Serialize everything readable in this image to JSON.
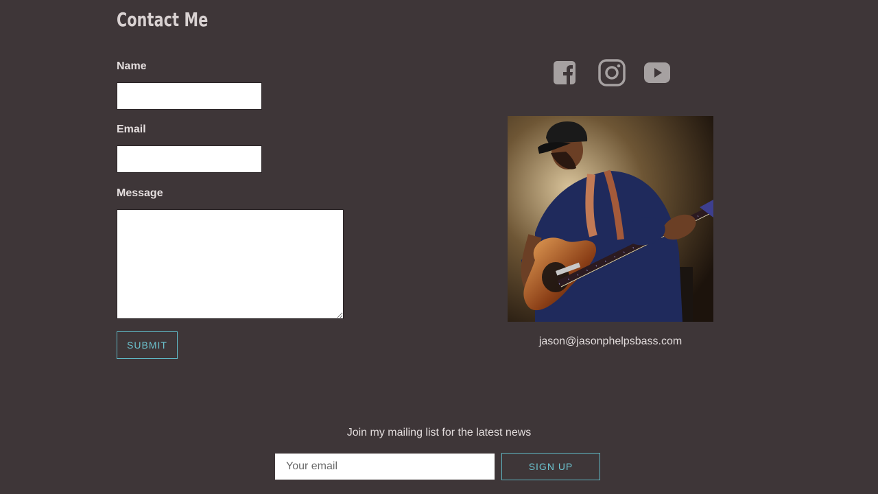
{
  "page": {
    "title": "Contact Me"
  },
  "form": {
    "name_label": "Name",
    "email_label": "Email",
    "message_label": "Message",
    "name_value": "",
    "email_value": "",
    "message_value": "",
    "submit_label": "SUBMIT"
  },
  "social": {
    "icons": [
      "facebook-icon",
      "instagram-icon",
      "youtube-icon"
    ],
    "icon_color": "#a6a1a1"
  },
  "contact": {
    "email": "jason@jasonphelpsbass.com"
  },
  "newsletter": {
    "heading": "Join my mailing list for the latest news",
    "placeholder": "Your email",
    "signup_label": "SIGN UP"
  },
  "colors": {
    "background": "#3e3638",
    "accent": "#5fb7c4",
    "text": "#e2dcdc"
  }
}
